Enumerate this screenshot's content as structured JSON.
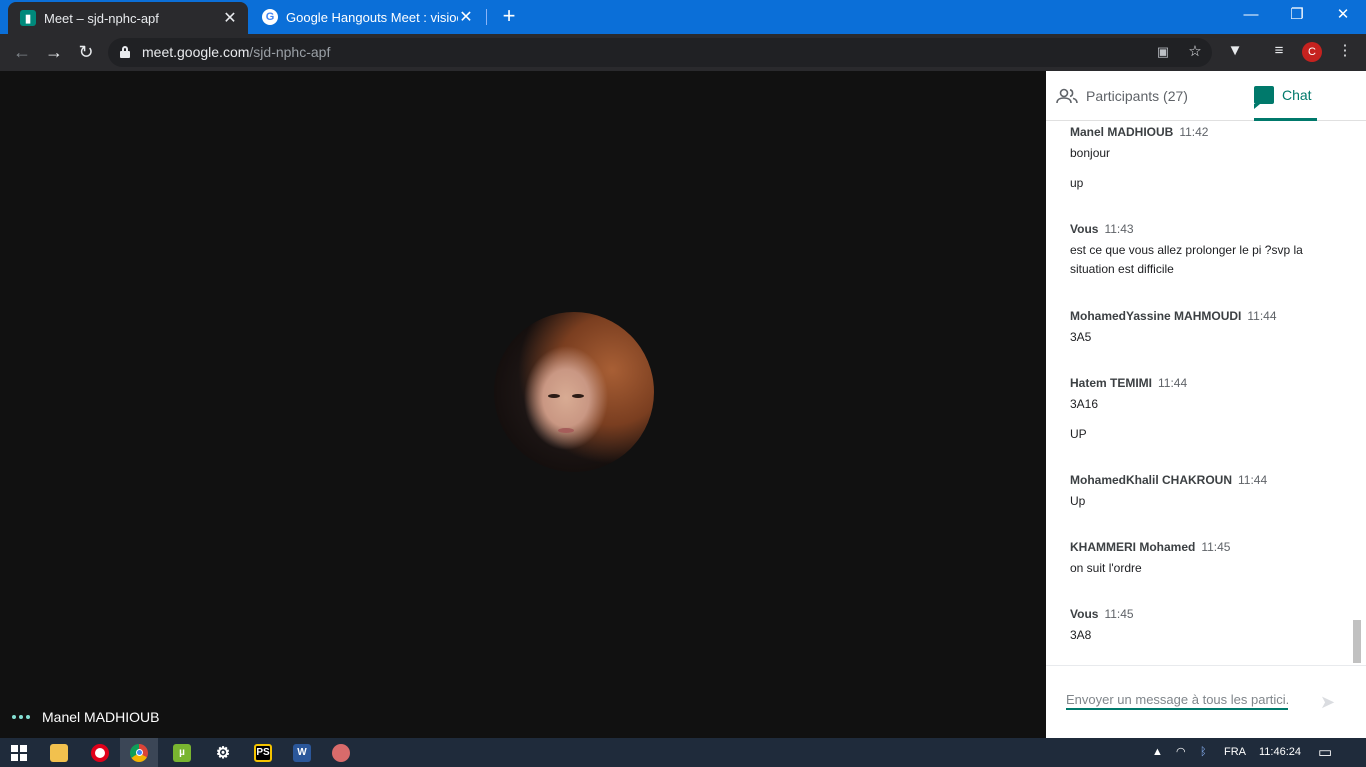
{
  "browser": {
    "tabs": [
      {
        "title": "Meet – sjd-nphc-apf",
        "active": true
      },
      {
        "title": "Google Hangouts Meet : visiocor",
        "active": false
      }
    ],
    "url_host": "meet.google.com",
    "url_path": "/sjd-nphc-apf",
    "profile_initial": "C"
  },
  "stage": {
    "speaker_name": "Manel MADHIOUB"
  },
  "panel": {
    "participants_label": "Participants (27)",
    "chat_label": "Chat",
    "messages": [
      {
        "sender": "Manel MADHIOUB",
        "time": "11:42",
        "lines": [
          "bonjour",
          "up"
        ]
      },
      {
        "sender": "Vous",
        "time": "11:43",
        "lines": [
          "est ce que vous allez prolonger le pi ?svp la situation est difficile"
        ]
      },
      {
        "sender": "MohamedYassine MAHMOUDI",
        "time": "11:44",
        "lines": [
          "3A5"
        ]
      },
      {
        "sender": "Hatem TEMIMI",
        "time": "11:44",
        "lines": [
          "3A16",
          "UP"
        ]
      },
      {
        "sender": "MohamedKhalil CHAKROUN",
        "time": "11:44",
        "lines": [
          "Up"
        ]
      },
      {
        "sender": "KHAMMERI Mohamed",
        "time": "11:45",
        "lines": [
          "on suit l'ordre"
        ]
      },
      {
        "sender": "Vous",
        "time": "11:45",
        "lines": [
          "3A8"
        ]
      }
    ],
    "compose_placeholder": "Envoyer un message à tous les partici..."
  },
  "taskbar": {
    "apps": [
      "windows-start",
      "file-explorer",
      "opera",
      "chrome",
      "utorrent",
      "settings",
      "phpstorm",
      "word",
      "snipping-tool"
    ],
    "tray_language": "FRA",
    "clock": "11:46:24"
  },
  "colors": {
    "accent": "#00796b",
    "tabstrip": "#0b6fd8",
    "toolbar": "#2a2a2d",
    "stage": "#111111"
  }
}
